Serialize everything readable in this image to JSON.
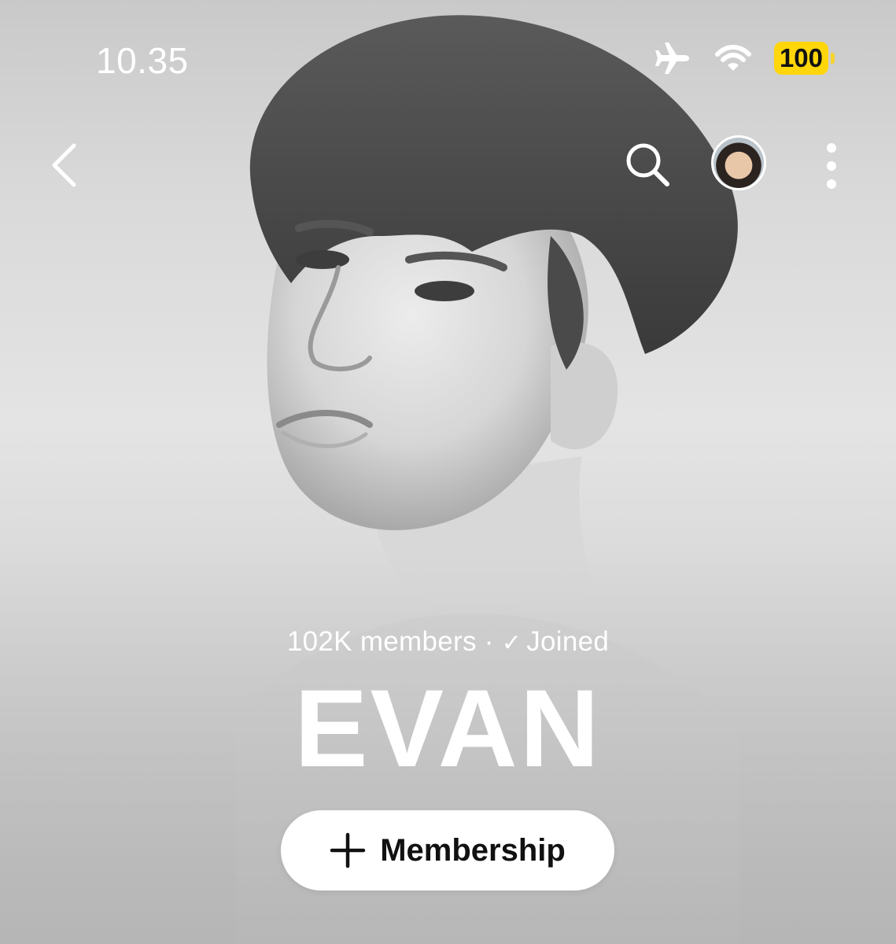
{
  "status_bar": {
    "time": "10.35",
    "battery_level": "100",
    "icons": [
      "airplane-mode-icon",
      "wifi-icon",
      "battery-icon"
    ],
    "battery_color": "#ffd60a"
  },
  "nav": {
    "icons": [
      "back-chevron-icon",
      "search-icon",
      "profile-avatar",
      "more-vertical-icon"
    ]
  },
  "community": {
    "members": "102K members",
    "separator": "·",
    "joined_label": "Joined",
    "name": "EVAN"
  },
  "membership_button": {
    "label": "Membership",
    "icon": "plus-icon"
  },
  "colors": {
    "text_on_photo": "#ffffff",
    "button_bg": "#ffffff",
    "button_text": "#111111"
  }
}
